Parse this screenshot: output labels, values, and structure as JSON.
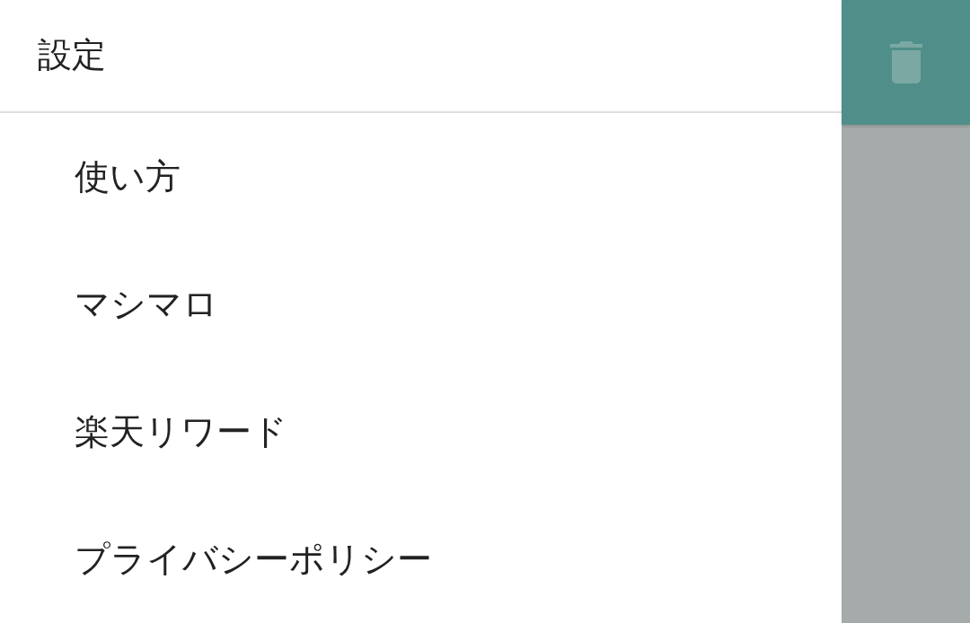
{
  "drawer": {
    "title": "設定",
    "items": [
      {
        "label": "使い方"
      },
      {
        "label": "マシマロ"
      },
      {
        "label": "楽天リワード"
      },
      {
        "label": "プライバシーポリシー"
      }
    ]
  },
  "background": {
    "app_bar": {
      "actions": [
        {
          "kind": "delete"
        }
      ]
    }
  }
}
